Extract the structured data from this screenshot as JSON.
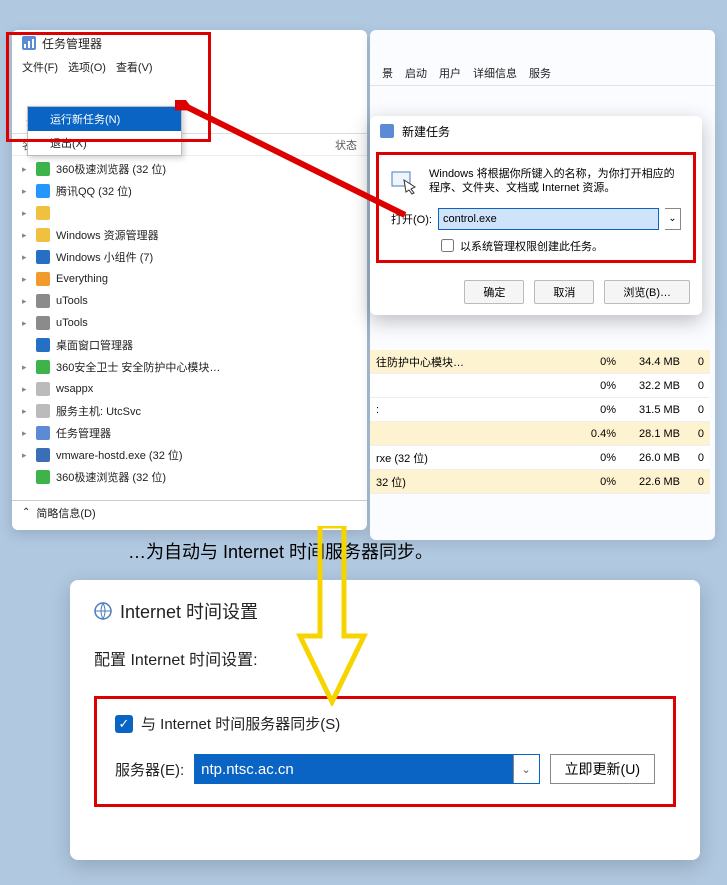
{
  "task_manager": {
    "title": "任务管理器",
    "menu": {
      "file": "文件(F)",
      "options": "选项(O)",
      "view": "查看(V)"
    },
    "dropdown": {
      "run_new": "运行新任务(N)",
      "exit": "退出(X)"
    },
    "tabs": [
      "动",
      "用户",
      "详细信息",
      "服务"
    ],
    "columns": {
      "name": "名称",
      "status": "状态"
    },
    "processes": [
      {
        "name": "360极速浏览器 (32 位)",
        "icon_color": "#3db34a",
        "expand": true
      },
      {
        "name": "腾讯QQ (32 位)",
        "icon_color": "#2596ff",
        "expand": true
      },
      {
        "name": "",
        "icon_color": "#f0c040",
        "expand": true,
        "blank": true
      },
      {
        "name": "Windows 资源管理器",
        "icon_color": "#f0c040",
        "expand": true
      },
      {
        "name": "Windows 小组件 (7)",
        "icon_color": "#2570c4",
        "expand": true
      },
      {
        "name": "Everything",
        "icon_color": "#f29b2b",
        "expand": true
      },
      {
        "name": "uTools",
        "icon_color": "#8b8b8b",
        "expand": true
      },
      {
        "name": "uTools",
        "icon_color": "#8b8b8b",
        "expand": true
      },
      {
        "name": "桌面窗口管理器",
        "icon_color": "#2570c4",
        "expand": false
      },
      {
        "name": "360安全卫士 安全防护中心模块…",
        "icon_color": "#3db34a",
        "expand": true
      },
      {
        "name": "wsappx",
        "icon_color": "#bbb",
        "expand": true
      },
      {
        "name": "服务主机: UtcSvc",
        "icon_color": "#bbb",
        "expand": true
      },
      {
        "name": "任务管理器",
        "icon_color": "#5a8bd4",
        "expand": true
      },
      {
        "name": "vmware-hostd.exe (32 位)",
        "icon_color": "#3b6fb5",
        "expand": true
      },
      {
        "name": "360极速浏览器 (32 位)",
        "icon_color": "#3db34a",
        "expand": false
      }
    ],
    "footer": "简略信息(D)"
  },
  "run_dialog": {
    "right_tabs": [
      "景",
      "启动",
      "用户",
      "详细信息",
      "服务"
    ],
    "title": "新建任务",
    "description": "Windows 将根据你所键入的名称，为你打开相应的程序、文件夹、文档或 Internet 资源。",
    "open_label": "打开(O):",
    "open_value": "control.exe",
    "admin_label": "以系统管理权限创建此任务。",
    "buttons": {
      "ok": "确定",
      "cancel": "取消",
      "browse": "浏览(B)…"
    }
  },
  "proc_rows": [
    {
      "name": "往防护中心模块…",
      "cpu": "0%",
      "mem": "34.4 MB",
      "last": "0",
      "hl": true
    },
    {
      "name": "",
      "cpu": "0%",
      "mem": "32.2 MB",
      "last": "0",
      "hl": false
    },
    {
      "name": ":",
      "cpu": "0%",
      "mem": "31.5 MB",
      "last": "0",
      "hl": false
    },
    {
      "name": "",
      "cpu": "0.4%",
      "mem": "28.1 MB",
      "last": "0",
      "hl": true
    },
    {
      "name": "rxe (32 位)",
      "cpu": "0%",
      "mem": "26.0 MB",
      "last": "0",
      "hl": false
    },
    {
      "name": "32 位)",
      "cpu": "0%",
      "mem": "22.6 MB",
      "last": "0",
      "hl": true
    }
  ],
  "bottom_caption": "…为自动与 Internet 时间服务器同步。",
  "internet_time": {
    "title": "Internet 时间设置",
    "subtitle": "配置 Internet 时间设置:",
    "sync_label": "与 Internet 时间服务器同步(S)",
    "server_label": "服务器(E):",
    "server_value": "ntp.ntsc.ac.cn",
    "update_button": "立即更新(U)"
  }
}
